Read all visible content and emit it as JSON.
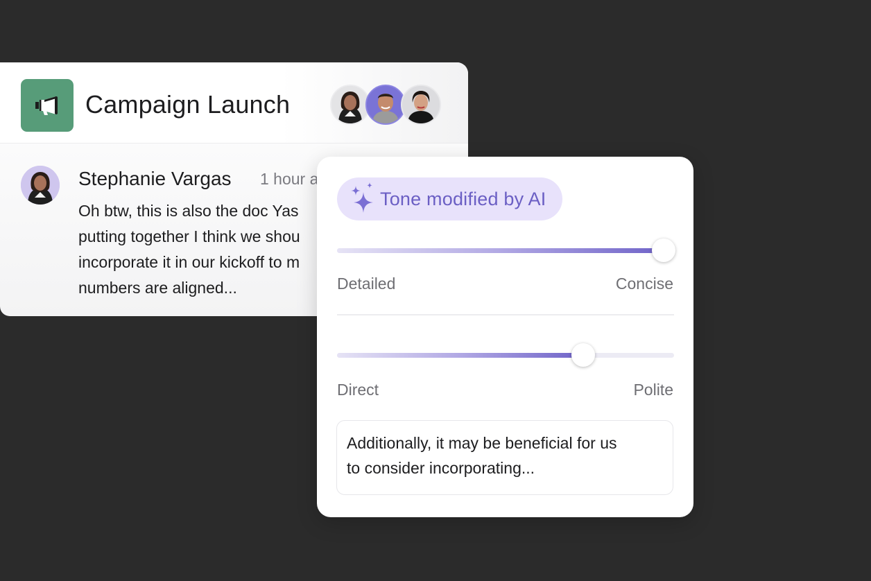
{
  "project": {
    "title": "Campaign Launch",
    "icon": "megaphone-icon",
    "icon_color": "#579c79",
    "members": [
      {
        "name": "member-avatar-1",
        "bg": "#dcdcdf"
      },
      {
        "name": "member-avatar-2",
        "bg": "#7a73d6"
      },
      {
        "name": "member-avatar-3",
        "bg": "#d8d8db"
      }
    ]
  },
  "comment": {
    "author": "Stephanie Vargas",
    "time": "1 hour a",
    "lines": [
      "Oh btw, this is also the doc Yas",
      "putting together I think we shou",
      "incorporate it in our kickoff to m",
      "numbers are aligned..."
    ]
  },
  "tone": {
    "badge_label": "Tone modified by AI",
    "badge_icon": "sparkle-icon",
    "accent": "#6b5fc4",
    "sliders": [
      {
        "left_label": "Detailed",
        "right_label": "Concise",
        "value": 0.97
      },
      {
        "left_label": "Direct",
        "right_label": "Polite",
        "value": 0.73
      }
    ],
    "preview_lines": [
      "Additionally, it may be beneficial for us",
      "to consider incorporating..."
    ]
  }
}
